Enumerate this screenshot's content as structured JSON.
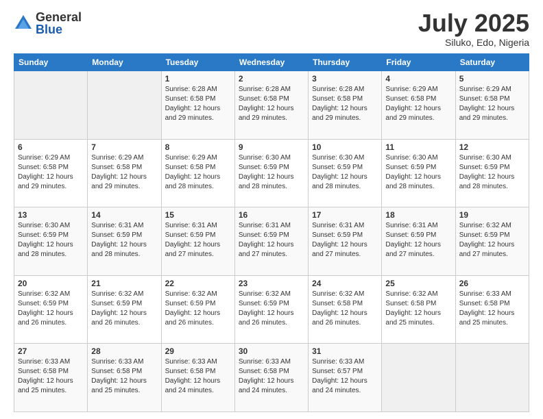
{
  "header": {
    "logo_general": "General",
    "logo_blue": "Blue",
    "month_title": "July 2025",
    "location": "Siluko, Edo, Nigeria"
  },
  "weekdays": [
    "Sunday",
    "Monday",
    "Tuesday",
    "Wednesday",
    "Thursday",
    "Friday",
    "Saturday"
  ],
  "weeks": [
    [
      {
        "day": "",
        "sunrise": "",
        "sunset": "",
        "daylight": ""
      },
      {
        "day": "",
        "sunrise": "",
        "sunset": "",
        "daylight": ""
      },
      {
        "day": "1",
        "sunrise": "Sunrise: 6:28 AM",
        "sunset": "Sunset: 6:58 PM",
        "daylight": "Daylight: 12 hours and 29 minutes."
      },
      {
        "day": "2",
        "sunrise": "Sunrise: 6:28 AM",
        "sunset": "Sunset: 6:58 PM",
        "daylight": "Daylight: 12 hours and 29 minutes."
      },
      {
        "day": "3",
        "sunrise": "Sunrise: 6:28 AM",
        "sunset": "Sunset: 6:58 PM",
        "daylight": "Daylight: 12 hours and 29 minutes."
      },
      {
        "day": "4",
        "sunrise": "Sunrise: 6:29 AM",
        "sunset": "Sunset: 6:58 PM",
        "daylight": "Daylight: 12 hours and 29 minutes."
      },
      {
        "day": "5",
        "sunrise": "Sunrise: 6:29 AM",
        "sunset": "Sunset: 6:58 PM",
        "daylight": "Daylight: 12 hours and 29 minutes."
      }
    ],
    [
      {
        "day": "6",
        "sunrise": "Sunrise: 6:29 AM",
        "sunset": "Sunset: 6:58 PM",
        "daylight": "Daylight: 12 hours and 29 minutes."
      },
      {
        "day": "7",
        "sunrise": "Sunrise: 6:29 AM",
        "sunset": "Sunset: 6:58 PM",
        "daylight": "Daylight: 12 hours and 29 minutes."
      },
      {
        "day": "8",
        "sunrise": "Sunrise: 6:29 AM",
        "sunset": "Sunset: 6:58 PM",
        "daylight": "Daylight: 12 hours and 28 minutes."
      },
      {
        "day": "9",
        "sunrise": "Sunrise: 6:30 AM",
        "sunset": "Sunset: 6:59 PM",
        "daylight": "Daylight: 12 hours and 28 minutes."
      },
      {
        "day": "10",
        "sunrise": "Sunrise: 6:30 AM",
        "sunset": "Sunset: 6:59 PM",
        "daylight": "Daylight: 12 hours and 28 minutes."
      },
      {
        "day": "11",
        "sunrise": "Sunrise: 6:30 AM",
        "sunset": "Sunset: 6:59 PM",
        "daylight": "Daylight: 12 hours and 28 minutes."
      },
      {
        "day": "12",
        "sunrise": "Sunrise: 6:30 AM",
        "sunset": "Sunset: 6:59 PM",
        "daylight": "Daylight: 12 hours and 28 minutes."
      }
    ],
    [
      {
        "day": "13",
        "sunrise": "Sunrise: 6:30 AM",
        "sunset": "Sunset: 6:59 PM",
        "daylight": "Daylight: 12 hours and 28 minutes."
      },
      {
        "day": "14",
        "sunrise": "Sunrise: 6:31 AM",
        "sunset": "Sunset: 6:59 PM",
        "daylight": "Daylight: 12 hours and 28 minutes."
      },
      {
        "day": "15",
        "sunrise": "Sunrise: 6:31 AM",
        "sunset": "Sunset: 6:59 PM",
        "daylight": "Daylight: 12 hours and 27 minutes."
      },
      {
        "day": "16",
        "sunrise": "Sunrise: 6:31 AM",
        "sunset": "Sunset: 6:59 PM",
        "daylight": "Daylight: 12 hours and 27 minutes."
      },
      {
        "day": "17",
        "sunrise": "Sunrise: 6:31 AM",
        "sunset": "Sunset: 6:59 PM",
        "daylight": "Daylight: 12 hours and 27 minutes."
      },
      {
        "day": "18",
        "sunrise": "Sunrise: 6:31 AM",
        "sunset": "Sunset: 6:59 PM",
        "daylight": "Daylight: 12 hours and 27 minutes."
      },
      {
        "day": "19",
        "sunrise": "Sunrise: 6:32 AM",
        "sunset": "Sunset: 6:59 PM",
        "daylight": "Daylight: 12 hours and 27 minutes."
      }
    ],
    [
      {
        "day": "20",
        "sunrise": "Sunrise: 6:32 AM",
        "sunset": "Sunset: 6:59 PM",
        "daylight": "Daylight: 12 hours and 26 minutes."
      },
      {
        "day": "21",
        "sunrise": "Sunrise: 6:32 AM",
        "sunset": "Sunset: 6:59 PM",
        "daylight": "Daylight: 12 hours and 26 minutes."
      },
      {
        "day": "22",
        "sunrise": "Sunrise: 6:32 AM",
        "sunset": "Sunset: 6:59 PM",
        "daylight": "Daylight: 12 hours and 26 minutes."
      },
      {
        "day": "23",
        "sunrise": "Sunrise: 6:32 AM",
        "sunset": "Sunset: 6:59 PM",
        "daylight": "Daylight: 12 hours and 26 minutes."
      },
      {
        "day": "24",
        "sunrise": "Sunrise: 6:32 AM",
        "sunset": "Sunset: 6:58 PM",
        "daylight": "Daylight: 12 hours and 26 minutes."
      },
      {
        "day": "25",
        "sunrise": "Sunrise: 6:32 AM",
        "sunset": "Sunset: 6:58 PM",
        "daylight": "Daylight: 12 hours and 25 minutes."
      },
      {
        "day": "26",
        "sunrise": "Sunrise: 6:33 AM",
        "sunset": "Sunset: 6:58 PM",
        "daylight": "Daylight: 12 hours and 25 minutes."
      }
    ],
    [
      {
        "day": "27",
        "sunrise": "Sunrise: 6:33 AM",
        "sunset": "Sunset: 6:58 PM",
        "daylight": "Daylight: 12 hours and 25 minutes."
      },
      {
        "day": "28",
        "sunrise": "Sunrise: 6:33 AM",
        "sunset": "Sunset: 6:58 PM",
        "daylight": "Daylight: 12 hours and 25 minutes."
      },
      {
        "day": "29",
        "sunrise": "Sunrise: 6:33 AM",
        "sunset": "Sunset: 6:58 PM",
        "daylight": "Daylight: 12 hours and 24 minutes."
      },
      {
        "day": "30",
        "sunrise": "Sunrise: 6:33 AM",
        "sunset": "Sunset: 6:58 PM",
        "daylight": "Daylight: 12 hours and 24 minutes."
      },
      {
        "day": "31",
        "sunrise": "Sunrise: 6:33 AM",
        "sunset": "Sunset: 6:57 PM",
        "daylight": "Daylight: 12 hours and 24 minutes."
      },
      {
        "day": "",
        "sunrise": "",
        "sunset": "",
        "daylight": ""
      },
      {
        "day": "",
        "sunrise": "",
        "sunset": "",
        "daylight": ""
      }
    ]
  ]
}
